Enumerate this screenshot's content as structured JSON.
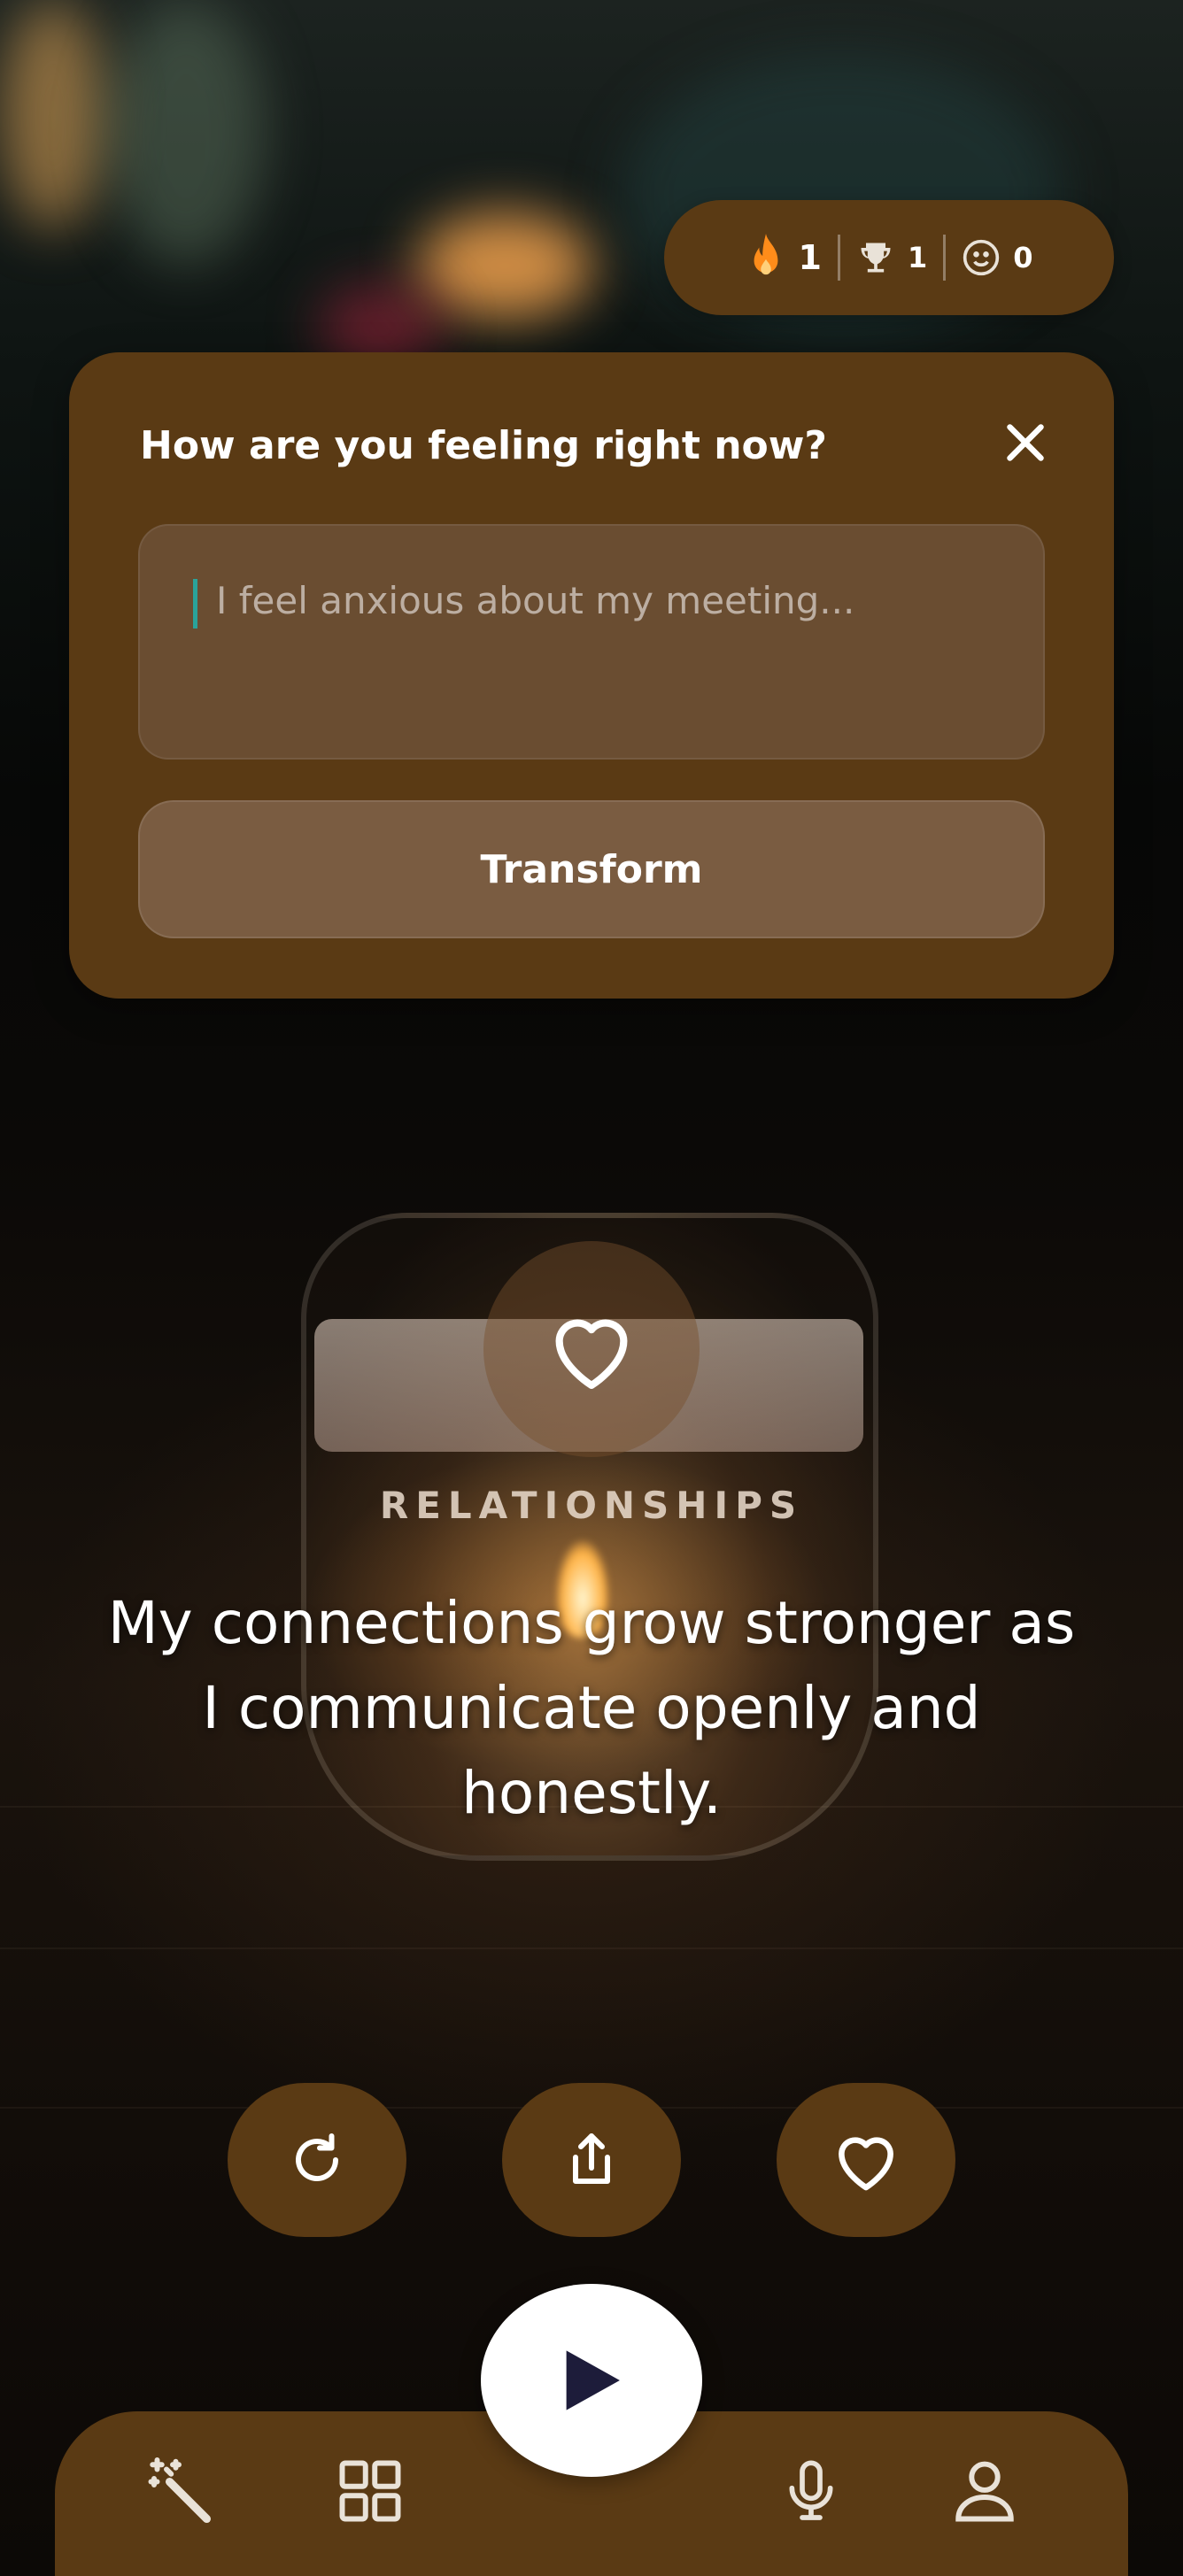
{
  "stats": {
    "streak": "1",
    "trophies": "1",
    "moods": "0"
  },
  "feeling_card": {
    "title": "How are you feeling right now?",
    "input_placeholder": "I feel anxious about my meeting...",
    "transform_label": "Transform"
  },
  "affirmation": {
    "category": "RELATIONSHIPS",
    "text": "My connections grow stronger as I communicate openly and honestly."
  },
  "actions": {
    "refresh_icon": "refresh-icon",
    "share_icon": "share-icon",
    "favorite_icon": "heart-icon",
    "play_icon": "play-icon"
  },
  "bottom_nav": [
    "magic-wand-icon",
    "grid-icon",
    "microphone-icon",
    "profile-icon"
  ],
  "colors": {
    "panel": "#5a3a14",
    "input_bg": "#6a4d31",
    "button_bg": "#7a5c41",
    "flame": "#ff8c1a",
    "caret": "#2aa39a"
  }
}
